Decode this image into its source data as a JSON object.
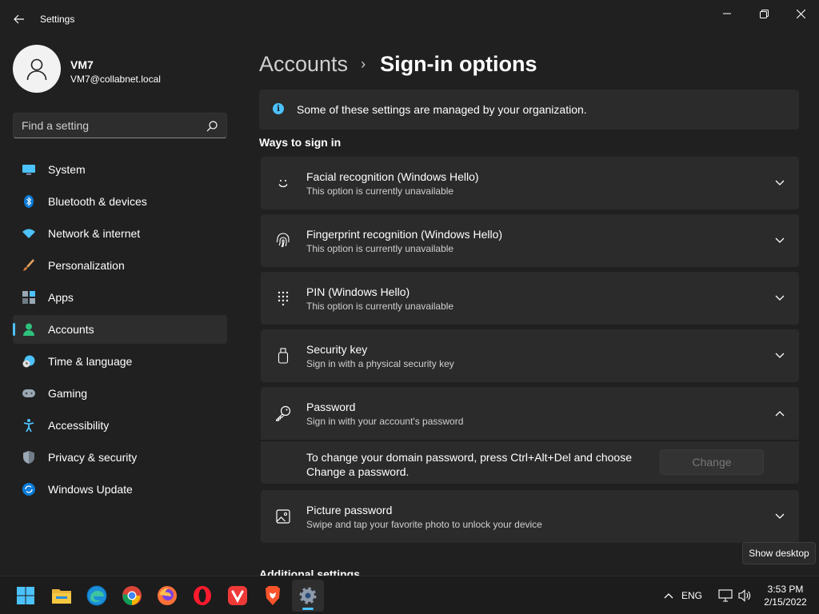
{
  "window": {
    "title": "Settings"
  },
  "profile": {
    "name": "VM7",
    "email": "VM7@collabnet.local"
  },
  "search": {
    "placeholder": "Find a setting"
  },
  "sidebar": {
    "items": [
      {
        "label": "System",
        "icon": "system-icon"
      },
      {
        "label": "Bluetooth & devices",
        "icon": "bluetooth-icon"
      },
      {
        "label": "Network & internet",
        "icon": "wifi-icon"
      },
      {
        "label": "Personalization",
        "icon": "brush-icon"
      },
      {
        "label": "Apps",
        "icon": "apps-icon"
      },
      {
        "label": "Accounts",
        "icon": "account-icon",
        "selected": true
      },
      {
        "label": "Time & language",
        "icon": "clock-globe-icon"
      },
      {
        "label": "Gaming",
        "icon": "controller-icon"
      },
      {
        "label": "Accessibility",
        "icon": "accessibility-icon"
      },
      {
        "label": "Privacy & security",
        "icon": "shield-icon"
      },
      {
        "label": "Windows Update",
        "icon": "update-icon"
      }
    ]
  },
  "main": {
    "breadcrumb_parent": "Accounts",
    "breadcrumb_separator": "›",
    "breadcrumb_current": "Sign-in options",
    "info_text": "Some of these settings are managed by your organization.",
    "section_title": "Ways to sign in",
    "cards": [
      {
        "title": "Facial recognition (Windows Hello)",
        "subtitle": "This option is currently unavailable",
        "icon": "face-icon"
      },
      {
        "title": "Fingerprint recognition (Windows Hello)",
        "subtitle": "This option is currently unavailable",
        "icon": "fingerprint-icon"
      },
      {
        "title": "PIN (Windows Hello)",
        "subtitle": "This option is currently unavailable",
        "icon": "pin-keypad-icon"
      },
      {
        "title": "Security key",
        "subtitle": "Sign in with a physical security key",
        "icon": "usb-key-icon"
      },
      {
        "title": "Password",
        "subtitle": "Sign in with your account's password",
        "icon": "key-icon",
        "expanded": true
      },
      {
        "title": "Picture password",
        "subtitle": "Swipe and tap your favorite photo to unlock your device",
        "icon": "picture-icon"
      }
    ],
    "password_help": "To change your domain password, press Ctrl+Alt+Del and choose Change a password.",
    "change_button": "Change",
    "additional_settings": "Additional settings"
  },
  "tooltip": {
    "text": "Show desktop"
  },
  "taskbar": {
    "apps": [
      "start-icon",
      "file-explorer-icon",
      "edge-icon",
      "chrome-icon",
      "firefox-icon",
      "opera-icon",
      "vivaldi-icon",
      "brave-icon",
      "settings-icon"
    ],
    "active_app": "settings-icon",
    "language": "ENG",
    "time": "3:53 PM",
    "date": "2/15/2022"
  },
  "colors": {
    "background": "#202020",
    "card": "#2b2b2b",
    "accent": "#4cc2ff"
  }
}
